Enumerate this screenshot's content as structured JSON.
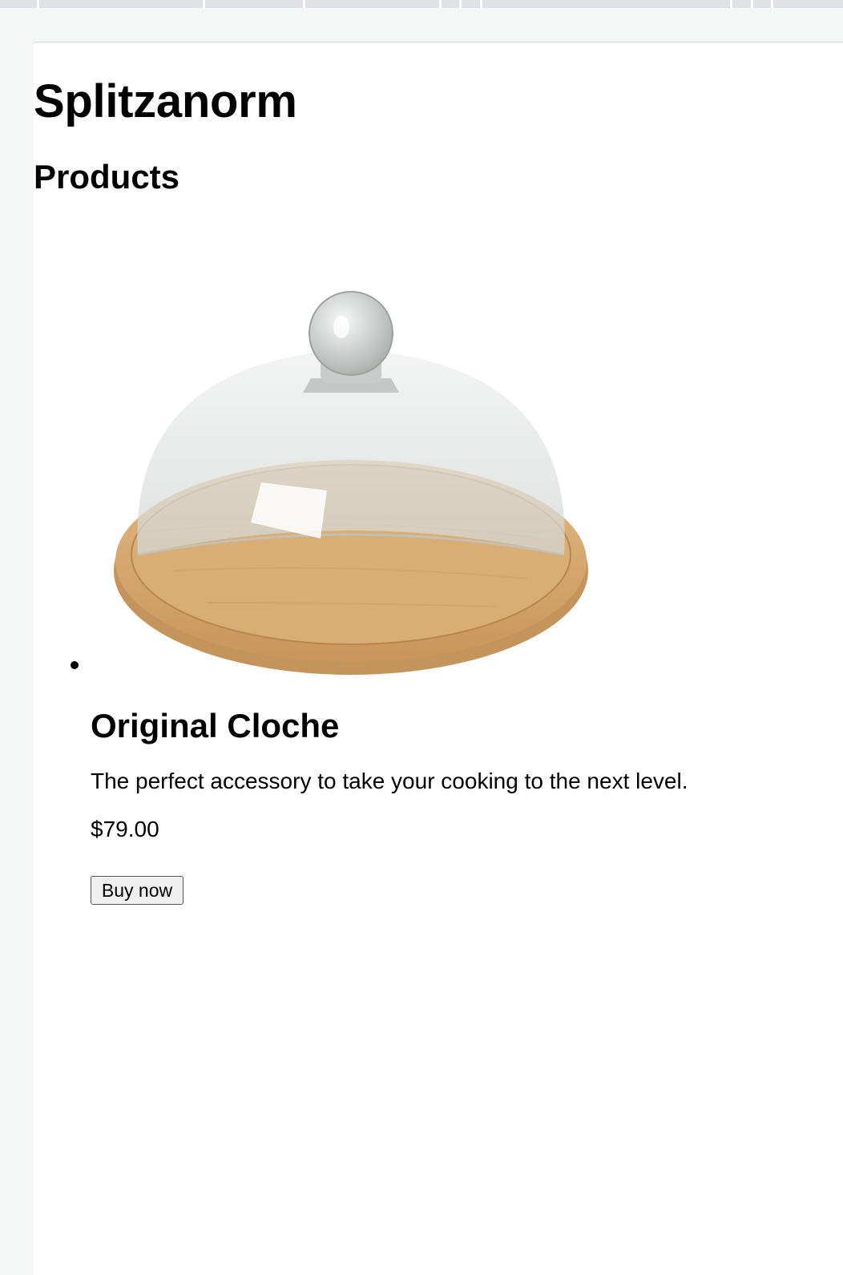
{
  "site": {
    "title": "Splitzanorm"
  },
  "products_section": {
    "heading": "Products",
    "items": [
      {
        "name": "Original Cloche",
        "description": "The perfect accessory to take your cooking to the next level.",
        "price": "$79.00",
        "buy_label": "Buy now",
        "image": "glass-cloche-on-wooden-board"
      }
    ]
  },
  "colors": {
    "page_background": "#ffffff",
    "browser_chrome": "#f5f6f6",
    "wood": "#d9ae74",
    "glass": "#d6d9d7"
  }
}
